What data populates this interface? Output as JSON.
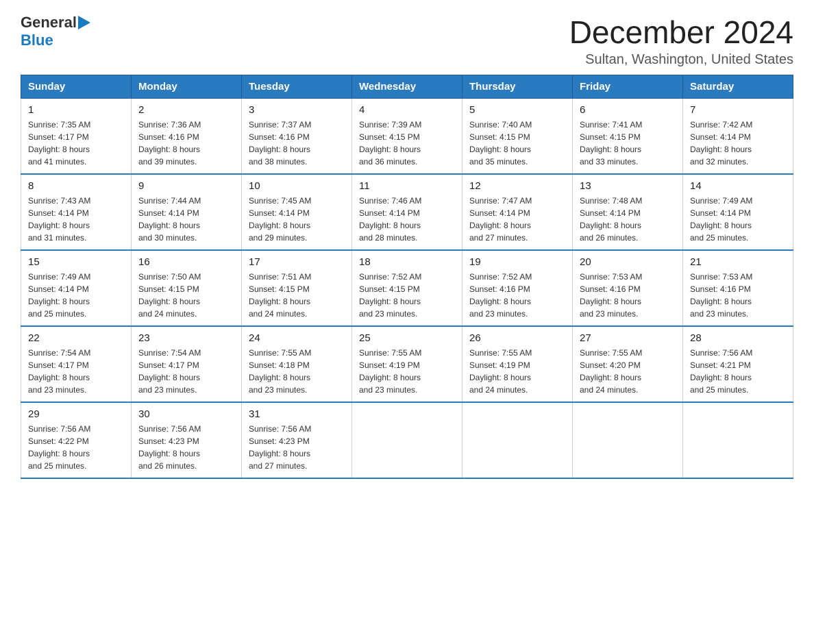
{
  "header": {
    "logo_general": "General",
    "logo_blue": "Blue",
    "month_title": "December 2024",
    "location": "Sultan, Washington, United States"
  },
  "weekdays": [
    "Sunday",
    "Monday",
    "Tuesday",
    "Wednesday",
    "Thursday",
    "Friday",
    "Saturday"
  ],
  "weeks": [
    [
      {
        "day": "1",
        "sunrise": "7:35 AM",
        "sunset": "4:17 PM",
        "daylight": "8 hours and 41 minutes."
      },
      {
        "day": "2",
        "sunrise": "7:36 AM",
        "sunset": "4:16 PM",
        "daylight": "8 hours and 39 minutes."
      },
      {
        "day": "3",
        "sunrise": "7:37 AM",
        "sunset": "4:16 PM",
        "daylight": "8 hours and 38 minutes."
      },
      {
        "day": "4",
        "sunrise": "7:39 AM",
        "sunset": "4:15 PM",
        "daylight": "8 hours and 36 minutes."
      },
      {
        "day": "5",
        "sunrise": "7:40 AM",
        "sunset": "4:15 PM",
        "daylight": "8 hours and 35 minutes."
      },
      {
        "day": "6",
        "sunrise": "7:41 AM",
        "sunset": "4:15 PM",
        "daylight": "8 hours and 33 minutes."
      },
      {
        "day": "7",
        "sunrise": "7:42 AM",
        "sunset": "4:14 PM",
        "daylight": "8 hours and 32 minutes."
      }
    ],
    [
      {
        "day": "8",
        "sunrise": "7:43 AM",
        "sunset": "4:14 PM",
        "daylight": "8 hours and 31 minutes."
      },
      {
        "day": "9",
        "sunrise": "7:44 AM",
        "sunset": "4:14 PM",
        "daylight": "8 hours and 30 minutes."
      },
      {
        "day": "10",
        "sunrise": "7:45 AM",
        "sunset": "4:14 PM",
        "daylight": "8 hours and 29 minutes."
      },
      {
        "day": "11",
        "sunrise": "7:46 AM",
        "sunset": "4:14 PM",
        "daylight": "8 hours and 28 minutes."
      },
      {
        "day": "12",
        "sunrise": "7:47 AM",
        "sunset": "4:14 PM",
        "daylight": "8 hours and 27 minutes."
      },
      {
        "day": "13",
        "sunrise": "7:48 AM",
        "sunset": "4:14 PM",
        "daylight": "8 hours and 26 minutes."
      },
      {
        "day": "14",
        "sunrise": "7:49 AM",
        "sunset": "4:14 PM",
        "daylight": "8 hours and 25 minutes."
      }
    ],
    [
      {
        "day": "15",
        "sunrise": "7:49 AM",
        "sunset": "4:14 PM",
        "daylight": "8 hours and 25 minutes."
      },
      {
        "day": "16",
        "sunrise": "7:50 AM",
        "sunset": "4:15 PM",
        "daylight": "8 hours and 24 minutes."
      },
      {
        "day": "17",
        "sunrise": "7:51 AM",
        "sunset": "4:15 PM",
        "daylight": "8 hours and 24 minutes."
      },
      {
        "day": "18",
        "sunrise": "7:52 AM",
        "sunset": "4:15 PM",
        "daylight": "8 hours and 23 minutes."
      },
      {
        "day": "19",
        "sunrise": "7:52 AM",
        "sunset": "4:16 PM",
        "daylight": "8 hours and 23 minutes."
      },
      {
        "day": "20",
        "sunrise": "7:53 AM",
        "sunset": "4:16 PM",
        "daylight": "8 hours and 23 minutes."
      },
      {
        "day": "21",
        "sunrise": "7:53 AM",
        "sunset": "4:16 PM",
        "daylight": "8 hours and 23 minutes."
      }
    ],
    [
      {
        "day": "22",
        "sunrise": "7:54 AM",
        "sunset": "4:17 PM",
        "daylight": "8 hours and 23 minutes."
      },
      {
        "day": "23",
        "sunrise": "7:54 AM",
        "sunset": "4:17 PM",
        "daylight": "8 hours and 23 minutes."
      },
      {
        "day": "24",
        "sunrise": "7:55 AM",
        "sunset": "4:18 PM",
        "daylight": "8 hours and 23 minutes."
      },
      {
        "day": "25",
        "sunrise": "7:55 AM",
        "sunset": "4:19 PM",
        "daylight": "8 hours and 23 minutes."
      },
      {
        "day": "26",
        "sunrise": "7:55 AM",
        "sunset": "4:19 PM",
        "daylight": "8 hours and 24 minutes."
      },
      {
        "day": "27",
        "sunrise": "7:55 AM",
        "sunset": "4:20 PM",
        "daylight": "8 hours and 24 minutes."
      },
      {
        "day": "28",
        "sunrise": "7:56 AM",
        "sunset": "4:21 PM",
        "daylight": "8 hours and 25 minutes."
      }
    ],
    [
      {
        "day": "29",
        "sunrise": "7:56 AM",
        "sunset": "4:22 PM",
        "daylight": "8 hours and 25 minutes."
      },
      {
        "day": "30",
        "sunrise": "7:56 AM",
        "sunset": "4:23 PM",
        "daylight": "8 hours and 26 minutes."
      },
      {
        "day": "31",
        "sunrise": "7:56 AM",
        "sunset": "4:23 PM",
        "daylight": "8 hours and 27 minutes."
      },
      null,
      null,
      null,
      null
    ]
  ],
  "labels": {
    "sunrise": "Sunrise:",
    "sunset": "Sunset:",
    "daylight": "Daylight:"
  }
}
